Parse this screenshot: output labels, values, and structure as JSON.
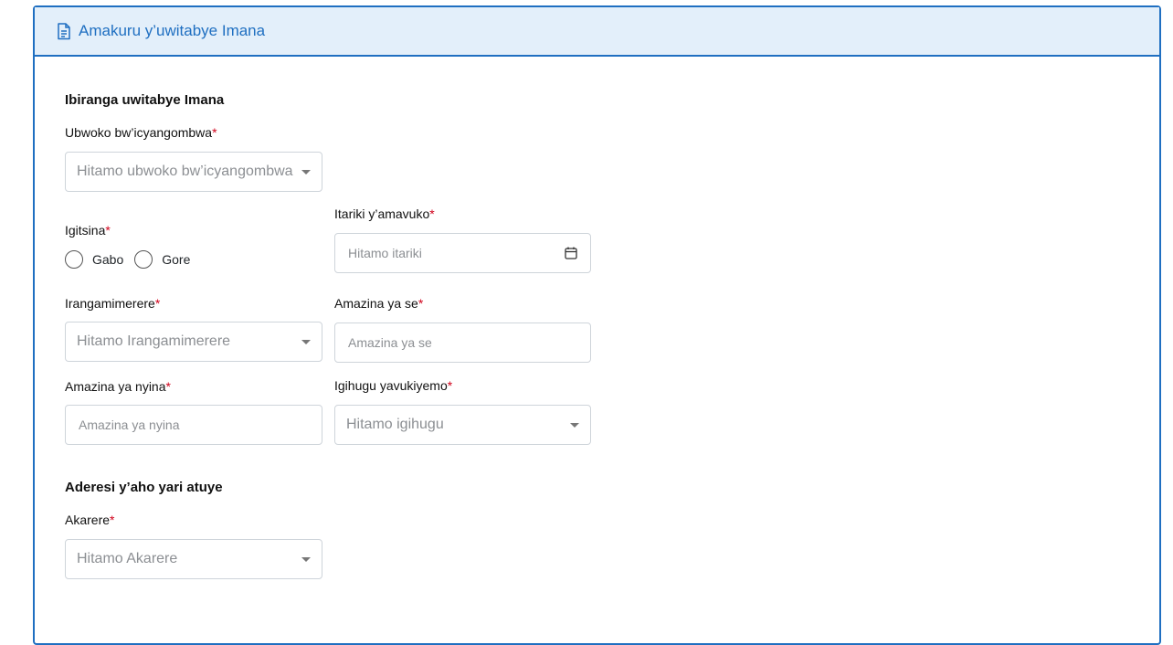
{
  "card": {
    "header_title": "Amakuru y’uwitabye Imana",
    "header_icon": "document-icon"
  },
  "deceased_section": {
    "title": "Ibiranga uwitabye Imana",
    "document_type": {
      "label": "Ubwoko bw’icyangombwa",
      "placeholder": "Hitamo ubwoko bw’icyangombwa"
    },
    "gender": {
      "label": "Igitsina",
      "options": [
        "Gabo",
        "Gore"
      ]
    },
    "birth_date": {
      "label": "Itariki y’amavuko",
      "placeholder": "Hitamo itariki",
      "icon": "calendar-icon"
    },
    "marital_status": {
      "label": "Irangamimerere",
      "placeholder": "Hitamo Irangamimerere"
    },
    "father_name": {
      "label": "Amazina ya se",
      "placeholder": "Amazina ya se"
    },
    "mother_name": {
      "label": "Amazina ya nyina",
      "placeholder": "Amazina ya nyina"
    },
    "birth_country": {
      "label": "Igihugu yavukiyemo",
      "placeholder": "Hitamo igihugu"
    }
  },
  "address_section": {
    "title": "Aderesi y’aho yari atuye",
    "district": {
      "label": "Akarere",
      "placeholder": "Hitamo Akarere"
    }
  },
  "required_mark": "*",
  "colors": {
    "accent": "#1f6fc1",
    "header_bg": "#e3effa",
    "required": "#d0021b",
    "border": "#ced4da"
  }
}
